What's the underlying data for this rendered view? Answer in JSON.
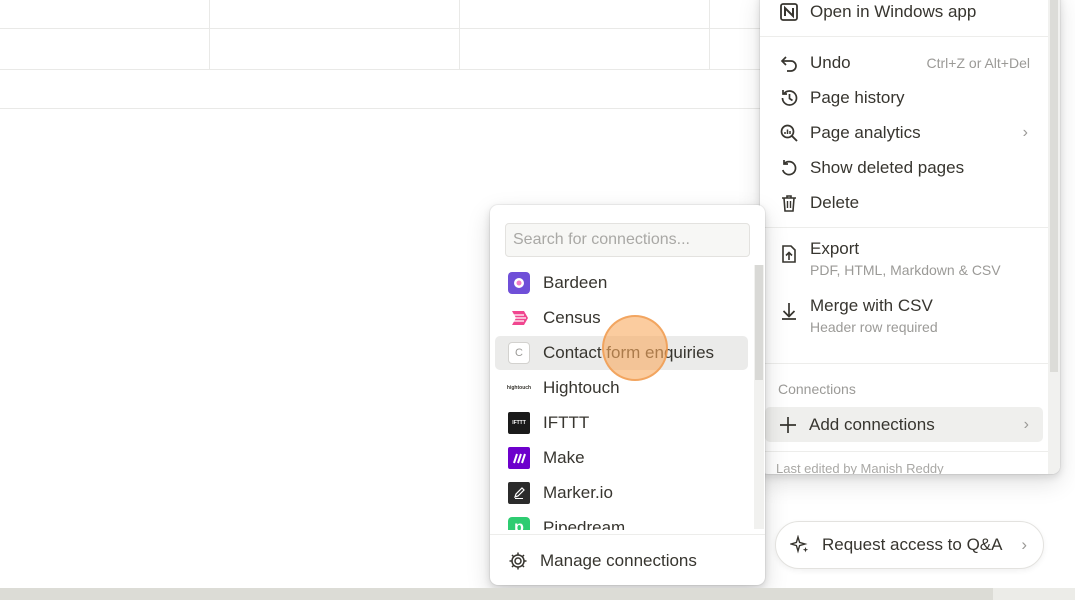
{
  "page_menu": {
    "open_in_app": "Open in Windows app",
    "undo": {
      "label": "Undo",
      "shortcut": "Ctrl+Z or Alt+Del"
    },
    "page_history": "Page history",
    "page_analytics": "Page analytics",
    "show_deleted": "Show deleted pages",
    "delete": "Delete",
    "export": {
      "label": "Export",
      "sub": "PDF, HTML, Markdown & CSV"
    },
    "merge": {
      "label": "Merge with CSV",
      "sub": "Header row required"
    },
    "connections_heading": "Connections",
    "add_connections": "Add connections",
    "last_edited": "Last edited by Manish Reddy"
  },
  "connections_popover": {
    "search_placeholder": "Search for connections...",
    "items": [
      {
        "name": "Bardeen",
        "icon": "bardeen-logo",
        "color": "#6f4fd8"
      },
      {
        "name": "Census",
        "icon": "census-logo",
        "color": "#f0468f"
      },
      {
        "name": "Contact form enquiries",
        "icon": "contact-form-logo",
        "letter": "C"
      },
      {
        "name": "Hightouch",
        "icon": "hightouch-logo",
        "letter": "hightouch"
      },
      {
        "name": "IFTTT",
        "icon": "ifttt-logo",
        "letter": "IFTTT",
        "color": "#1a1a1a"
      },
      {
        "name": "Make",
        "icon": "make-logo",
        "color": "#6d00cc"
      },
      {
        "name": "Marker.io",
        "icon": "marker-io-logo",
        "color": "#2b2b2b"
      },
      {
        "name": "Pipedream",
        "icon": "pipedream-logo",
        "letter": "p",
        "color": "#2ecc71"
      }
    ],
    "manage_label": "Manage connections"
  },
  "request_access": "Request access to Q&A"
}
